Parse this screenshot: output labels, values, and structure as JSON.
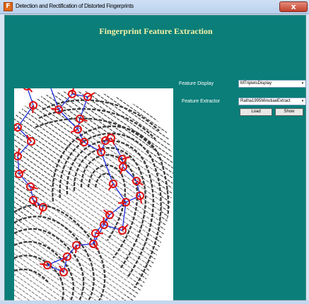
{
  "window": {
    "title": "Detection and Rectification of Distorted Fingerprints",
    "app_icon": "F",
    "close_glyph": "x"
  },
  "main": {
    "heading": "Fingerprint Feature Extraction",
    "feature_display": {
      "label": "Feature Display",
      "value": "MTripletsDisplay"
    },
    "feature_extractor": {
      "label": "Feature Extractor",
      "value": "Ratha1995MinutiaeExtract"
    },
    "load_label": "Load",
    "show_label": "Show"
  },
  "colors": {
    "background": "#0b7e79",
    "heading": "#f4f2a6",
    "minutia_marker": "#e01010",
    "triplet_line": "#1f2ee0"
  },
  "icons": {
    "combo_arrow": "dropdown-arrow-icon",
    "close": "close-icon",
    "app": "app-icon"
  }
}
